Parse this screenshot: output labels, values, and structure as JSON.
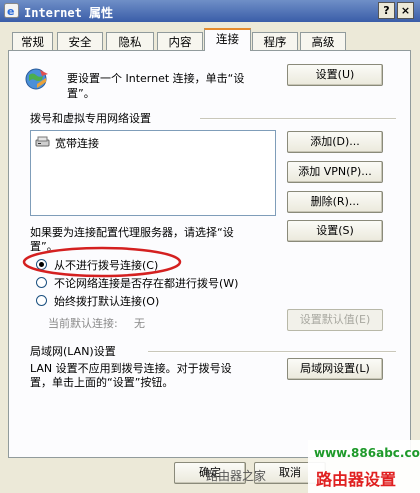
{
  "window": {
    "title": "Internet 属性",
    "help_glyph": "?",
    "close_glyph": "×"
  },
  "tabs": [
    {
      "label": "常规"
    },
    {
      "label": "安全"
    },
    {
      "label": "隐私"
    },
    {
      "label": "内容"
    },
    {
      "label": "连接"
    },
    {
      "label": "程序"
    },
    {
      "label": "高级"
    }
  ],
  "active_tab": "连接",
  "setup": {
    "text": "要设置一个 Internet 连接，单击“设置”。",
    "text_line1": "要设置一个 Internet 连接，单击“设",
    "text_line2": "置”。",
    "button": "设置(U)"
  },
  "dialup": {
    "heading": "拨号和虚拟专用网络设置",
    "list": [
      {
        "name": "宽带连接",
        "icon": "network-connection-icon"
      }
    ],
    "buttons": {
      "add": "添加(D)...",
      "add_vpn": "添加 VPN(P)...",
      "remove": "删除(R)...",
      "settings": "设置(S)"
    },
    "proxy_hint_line1": "如果要为连接配置代理服务器，请选择“设",
    "proxy_hint_line2": "置”。"
  },
  "radio_options": [
    {
      "label": "从不进行拨号连接(C)",
      "selected": true
    },
    {
      "label": "不论网络连接是否存在都进行拨号(W)",
      "selected": false
    },
    {
      "label": "始终拨打默认连接(O)",
      "selected": false
    }
  ],
  "default_connection": {
    "label": "当前默认连接:",
    "value": "无",
    "button": "设置默认值(E)"
  },
  "lan": {
    "heading": "局域网(LAN)设置",
    "text_line1": "LAN 设置不应用到拨号连接。对于拨号设",
    "text_line2": "置，单击上面的“设置”按钮。",
    "button": "局域网设置(L)"
  },
  "footer": {
    "ok": "确定",
    "cancel": "取消"
  },
  "watermarks": {
    "site": "www.886abc.com",
    "brand": "路由器设置",
    "overlay": "路由器之家"
  },
  "colors": {
    "highlight_circle": "#d42020",
    "watermark_green": "#1e9a2a",
    "watermark_red": "#e02020"
  }
}
